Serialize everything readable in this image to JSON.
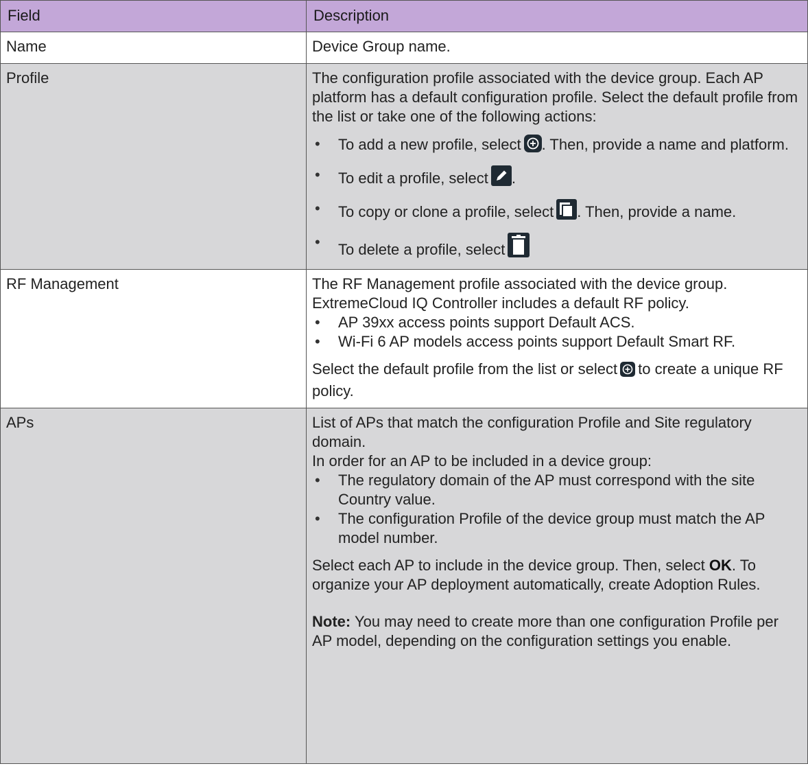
{
  "header": {
    "field": "Field",
    "description": "Description"
  },
  "rows": {
    "name": {
      "field": "Name",
      "desc": "Device Group name."
    },
    "profile": {
      "field": "Profile",
      "intro": "The configuration profile associated with the device group. Each AP platform has a default configuration profile. Select the default profile from the list or take one of the following actions:",
      "add_a": "To add a new profile, select",
      "add_b": ". Then, provide a name and platform.",
      "edit_a": "To edit a profile, select",
      "edit_b": ".",
      "copy_a": "To copy or clone a profile, select",
      "copy_b": ". Then, provide a name.",
      "delete_a": "To delete a profile, select"
    },
    "rf": {
      "field": "RF Management",
      "intro": "The RF Management profile associated with the device group. ExtremeCloud IQ Controller includes a default RF policy.",
      "bullet1": "AP 39xx access points support Default ACS.",
      "bullet2": "Wi-Fi 6 AP models access points support Default Smart RF.",
      "select_a": "Select the default profile from the list or select",
      "select_b": "to create a unique RF policy."
    },
    "aps": {
      "field": "APs",
      "intro1": "List of APs that match the configuration Profile and Site regulatory domain.",
      "intro2": "In order for an AP to be included in a device group:",
      "bullet1": "The regulatory domain of the AP must correspond with the site Country value.",
      "bullet2": "The configuration Profile of the device group must match the AP model number.",
      "sel_a": "Select each AP to include in the device group. Then, select",
      "sel_ok": "OK",
      "sel_b": ". To organize your AP deployment automatically, create Adoption Rules.",
      "note_label": "Note:",
      "note_text": "You may need to create more than one configuration Profile per AP model, depending on the configuration settings you enable."
    }
  },
  "colors": {
    "header_bg": "#c3a7d8",
    "row_grey": "#d7d7d9",
    "border": "#555555"
  }
}
